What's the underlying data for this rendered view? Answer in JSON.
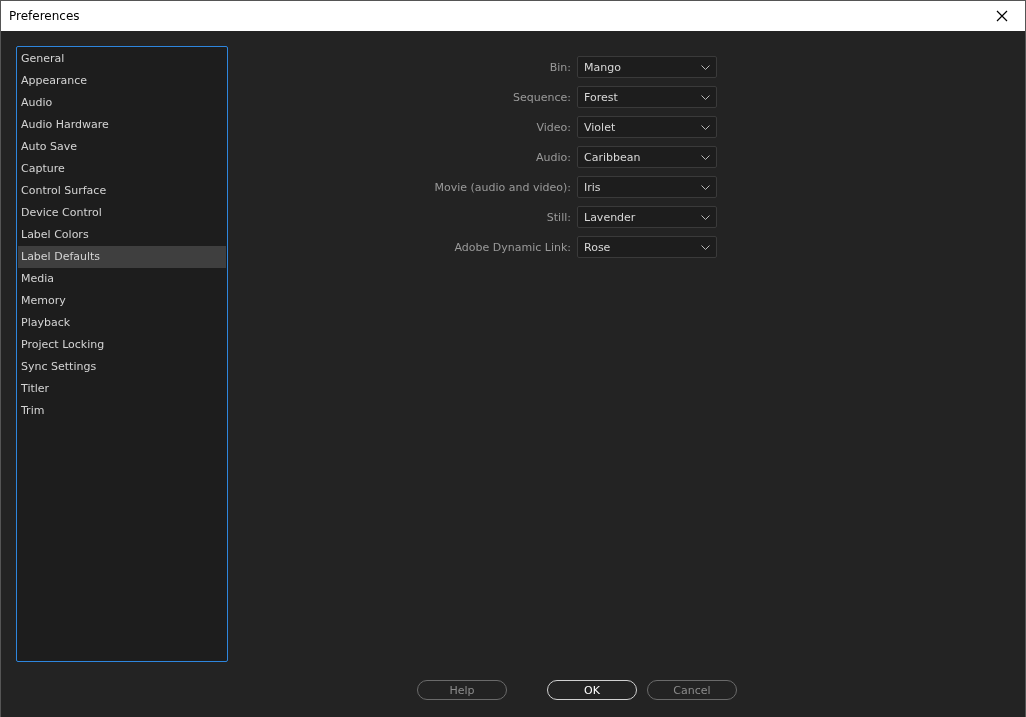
{
  "window": {
    "title": "Preferences"
  },
  "sidebar": {
    "items": [
      {
        "label": "General",
        "selected": false
      },
      {
        "label": "Appearance",
        "selected": false
      },
      {
        "label": "Audio",
        "selected": false
      },
      {
        "label": "Audio Hardware",
        "selected": false
      },
      {
        "label": "Auto Save",
        "selected": false
      },
      {
        "label": "Capture",
        "selected": false
      },
      {
        "label": "Control Surface",
        "selected": false
      },
      {
        "label": "Device Control",
        "selected": false
      },
      {
        "label": "Label Colors",
        "selected": false
      },
      {
        "label": "Label Defaults",
        "selected": true
      },
      {
        "label": "Media",
        "selected": false
      },
      {
        "label": "Memory",
        "selected": false
      },
      {
        "label": "Playback",
        "selected": false
      },
      {
        "label": "Project Locking",
        "selected": false
      },
      {
        "label": "Sync Settings",
        "selected": false
      },
      {
        "label": "Titler",
        "selected": false
      },
      {
        "label": "Trim",
        "selected": false
      }
    ]
  },
  "fields": [
    {
      "label": "Bin:",
      "value": "Mango"
    },
    {
      "label": "Sequence:",
      "value": "Forest"
    },
    {
      "label": "Video:",
      "value": "Violet"
    },
    {
      "label": "Audio:",
      "value": "Caribbean"
    },
    {
      "label": "Movie (audio and video):",
      "value": "Iris"
    },
    {
      "label": "Still:",
      "value": "Lavender"
    },
    {
      "label": "Adobe Dynamic Link:",
      "value": "Rose"
    }
  ],
  "buttons": [
    {
      "label": "Help",
      "default": false
    },
    {
      "label": "OK",
      "default": true
    },
    {
      "label": "Cancel",
      "default": false
    }
  ]
}
